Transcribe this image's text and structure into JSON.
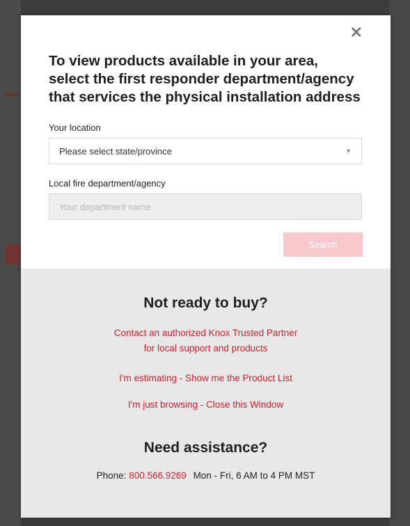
{
  "modal": {
    "close_glyph": "✕",
    "title": "To view products available in your area, select the first responder department/agency that services the physical installation address",
    "location_label": "Your location",
    "location_select_value": "Please select state/province",
    "department_label": "Local fire department/agency",
    "department_placeholder": "Your department name",
    "department_value": "",
    "search_label": "Search"
  },
  "footer": {
    "not_ready_heading": "Not ready to buy?",
    "contact_line1": "Contact an authorized Knox Trusted Partner",
    "contact_line2": "for local support and products",
    "estimating_link": "I'm estimating - Show me the Product List",
    "browsing_link": "I'm just browsing - Close this Window",
    "assistance_heading": "Need assistance?",
    "phone_label": "Phone:",
    "phone_number": "800.566.9269",
    "phone_hours": "Mon - Fri, 6 AM to 4 PM MST"
  },
  "colors": {
    "accent_red": "#d0202e",
    "search_button_disabled": "#f7c9cc",
    "overlay": "#3a3a3a",
    "bottom_panel": "#e8e8e8"
  },
  "icons": {
    "close": "close-icon",
    "select_arrow": "chevron-down-icon"
  }
}
